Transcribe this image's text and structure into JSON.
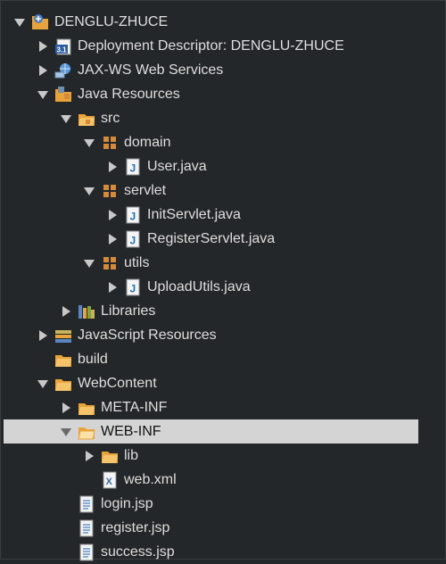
{
  "tree": {
    "items": [
      {
        "label": "DENGLU-ZHUCE",
        "icon": "project-icon",
        "arrow": "down"
      },
      {
        "label": "Deployment Descriptor: DENGLU-ZHUCE",
        "icon": "deployment-descriptor-icon",
        "arrow": "right"
      },
      {
        "label": "JAX-WS Web Services",
        "icon": "web-services-icon",
        "arrow": "right"
      },
      {
        "label": "Java Resources",
        "icon": "java-resources-icon",
        "arrow": "down"
      },
      {
        "label": "src",
        "icon": "source-folder-icon",
        "arrow": "down"
      },
      {
        "label": "domain",
        "icon": "package-icon",
        "arrow": "down"
      },
      {
        "label": "User.java",
        "icon": "java-file-icon",
        "arrow": "right"
      },
      {
        "label": "servlet",
        "icon": "package-icon",
        "arrow": "down"
      },
      {
        "label": "InitServlet.java",
        "icon": "java-file-icon",
        "arrow": "right"
      },
      {
        "label": "RegisterServlet.java",
        "icon": "java-file-icon",
        "arrow": "right"
      },
      {
        "label": "utils",
        "icon": "package-icon",
        "arrow": "down"
      },
      {
        "label": "UploadUtils.java",
        "icon": "java-file-icon",
        "arrow": "right"
      },
      {
        "label": "Libraries",
        "icon": "libraries-icon",
        "arrow": "right"
      },
      {
        "label": "JavaScript Resources",
        "icon": "libraries-icon",
        "arrow": "right"
      },
      {
        "label": "build",
        "icon": "folder-icon",
        "arrow": "none"
      },
      {
        "label": "WebContent",
        "icon": "folder-icon",
        "arrow": "down"
      },
      {
        "label": "META-INF",
        "icon": "folder-icon",
        "arrow": "right"
      },
      {
        "label": "WEB-INF",
        "icon": "folder-icon",
        "arrow": "down",
        "selected": true
      },
      {
        "label": "lib",
        "icon": "folder-icon",
        "arrow": "right"
      },
      {
        "label": "web.xml",
        "icon": "xml-file-icon",
        "arrow": "none"
      },
      {
        "label": "login.jsp",
        "icon": "jsp-file-icon",
        "arrow": "none"
      },
      {
        "label": "register.jsp",
        "icon": "jsp-file-icon",
        "arrow": "none"
      },
      {
        "label": "success.jsp",
        "icon": "jsp-file-icon",
        "arrow": "none"
      }
    ]
  },
  "colors": {
    "background": "#242729",
    "selection": "#d4d4d4",
    "text": "#dedede",
    "folder": "#e9a33b",
    "package": "#d58a3a",
    "java": "#2f6fb3"
  }
}
